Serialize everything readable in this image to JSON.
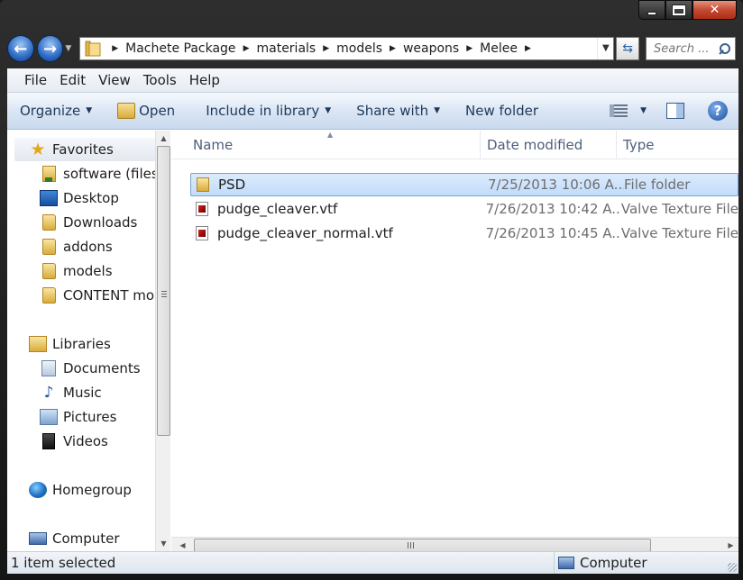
{
  "window": {
    "close_glyph": "✕"
  },
  "address": {
    "crumbs": [
      "Machete Package",
      "materials",
      "models",
      "weapons",
      "Melee"
    ],
    "separator": "▶",
    "search_placeholder": "Search ..."
  },
  "menubar": [
    "File",
    "Edit",
    "View",
    "Tools",
    "Help"
  ],
  "toolbar": {
    "organize": "Organize",
    "open": "Open",
    "include": "Include in library",
    "share": "Share with",
    "new_folder": "New folder"
  },
  "nav": {
    "favorites": "Favorites",
    "favorites_items": [
      "software (filese",
      "Desktop",
      "Downloads",
      "addons",
      "models",
      "CONTENT mod"
    ],
    "libraries": "Libraries",
    "library_items": [
      "Documents",
      "Music",
      "Pictures",
      "Videos"
    ],
    "homegroup": "Homegroup",
    "computer": "Computer"
  },
  "columns": {
    "name": "Name",
    "date": "Date modified",
    "type": "Type"
  },
  "files": [
    {
      "name": "PSD",
      "date": "7/25/2013 10:06 A...",
      "type": "File folder",
      "icon": "folder-icon",
      "selected": true
    },
    {
      "name": "pudge_cleaver.vtf",
      "date": "7/26/2013 10:42 A...",
      "type": "Valve Texture File",
      "icon": "vtf-file-icon",
      "selected": false
    },
    {
      "name": "pudge_cleaver_normal.vtf",
      "date": "7/26/2013 10:45 A...",
      "type": "Valve Texture File",
      "icon": "vtf-file-icon",
      "selected": false
    }
  ],
  "status": {
    "left": "1 item selected",
    "right": "Computer"
  },
  "colors": {
    "selection": "#cce4fc",
    "toolbar_text": "#1e395b",
    "close_button": "#c24a32"
  }
}
